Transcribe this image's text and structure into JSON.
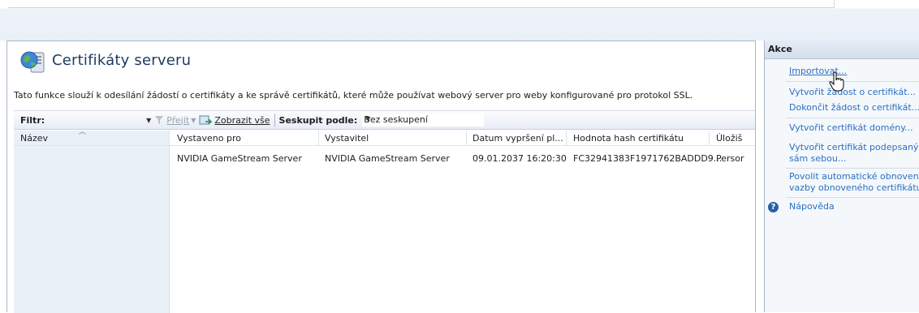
{
  "page": {
    "title": "Certifikáty serveru",
    "description": "Tato funkce slouží k odesílání žádostí o certifikáty a ke správě certifikátů, které může používat webový server pro weby konfigurované pro protokol SSL."
  },
  "filterbar": {
    "filter_label": "Filtr:",
    "filter_value": "",
    "goto_label": "Přejít",
    "show_all_label": "Zobrazit vše",
    "group_by_label": "Seskupit podle:",
    "group_by_value": "Bez seskupení"
  },
  "table": {
    "columns": [
      "Název",
      "Vystaveno pro",
      "Vystavitel",
      "Datum vypršení pl...",
      "Hodnota hash certifikátu",
      "Úložiš"
    ],
    "rows": [
      [
        "",
        "NVIDIA GameStream Server",
        "NVIDIA GameStream Server",
        "09.01.2037 16:20:30",
        "FC32941383F1971762BADDD9...",
        "Persor"
      ]
    ]
  },
  "actions": {
    "header": "Akce",
    "items": [
      {
        "label": "Importovat..."
      },
      {
        "label": "Vytvořit žádost o certifikát..."
      },
      {
        "label": "Dokončit žádost o certifikát..."
      },
      {
        "label": "Vytvořit certifikát domény..."
      },
      {
        "label": "Vytvořit certifikát podepsaný",
        "label2": "sám sebou..."
      },
      {
        "label": "Povolit automatické obnovení",
        "label2": "vazby obnoveného certifikátu"
      },
      {
        "label": "Nápověda"
      }
    ]
  },
  "colors": {
    "accent": "#2a6fc1",
    "title": "#1e3a5f",
    "name_column_bg": "#eaf0f7"
  }
}
